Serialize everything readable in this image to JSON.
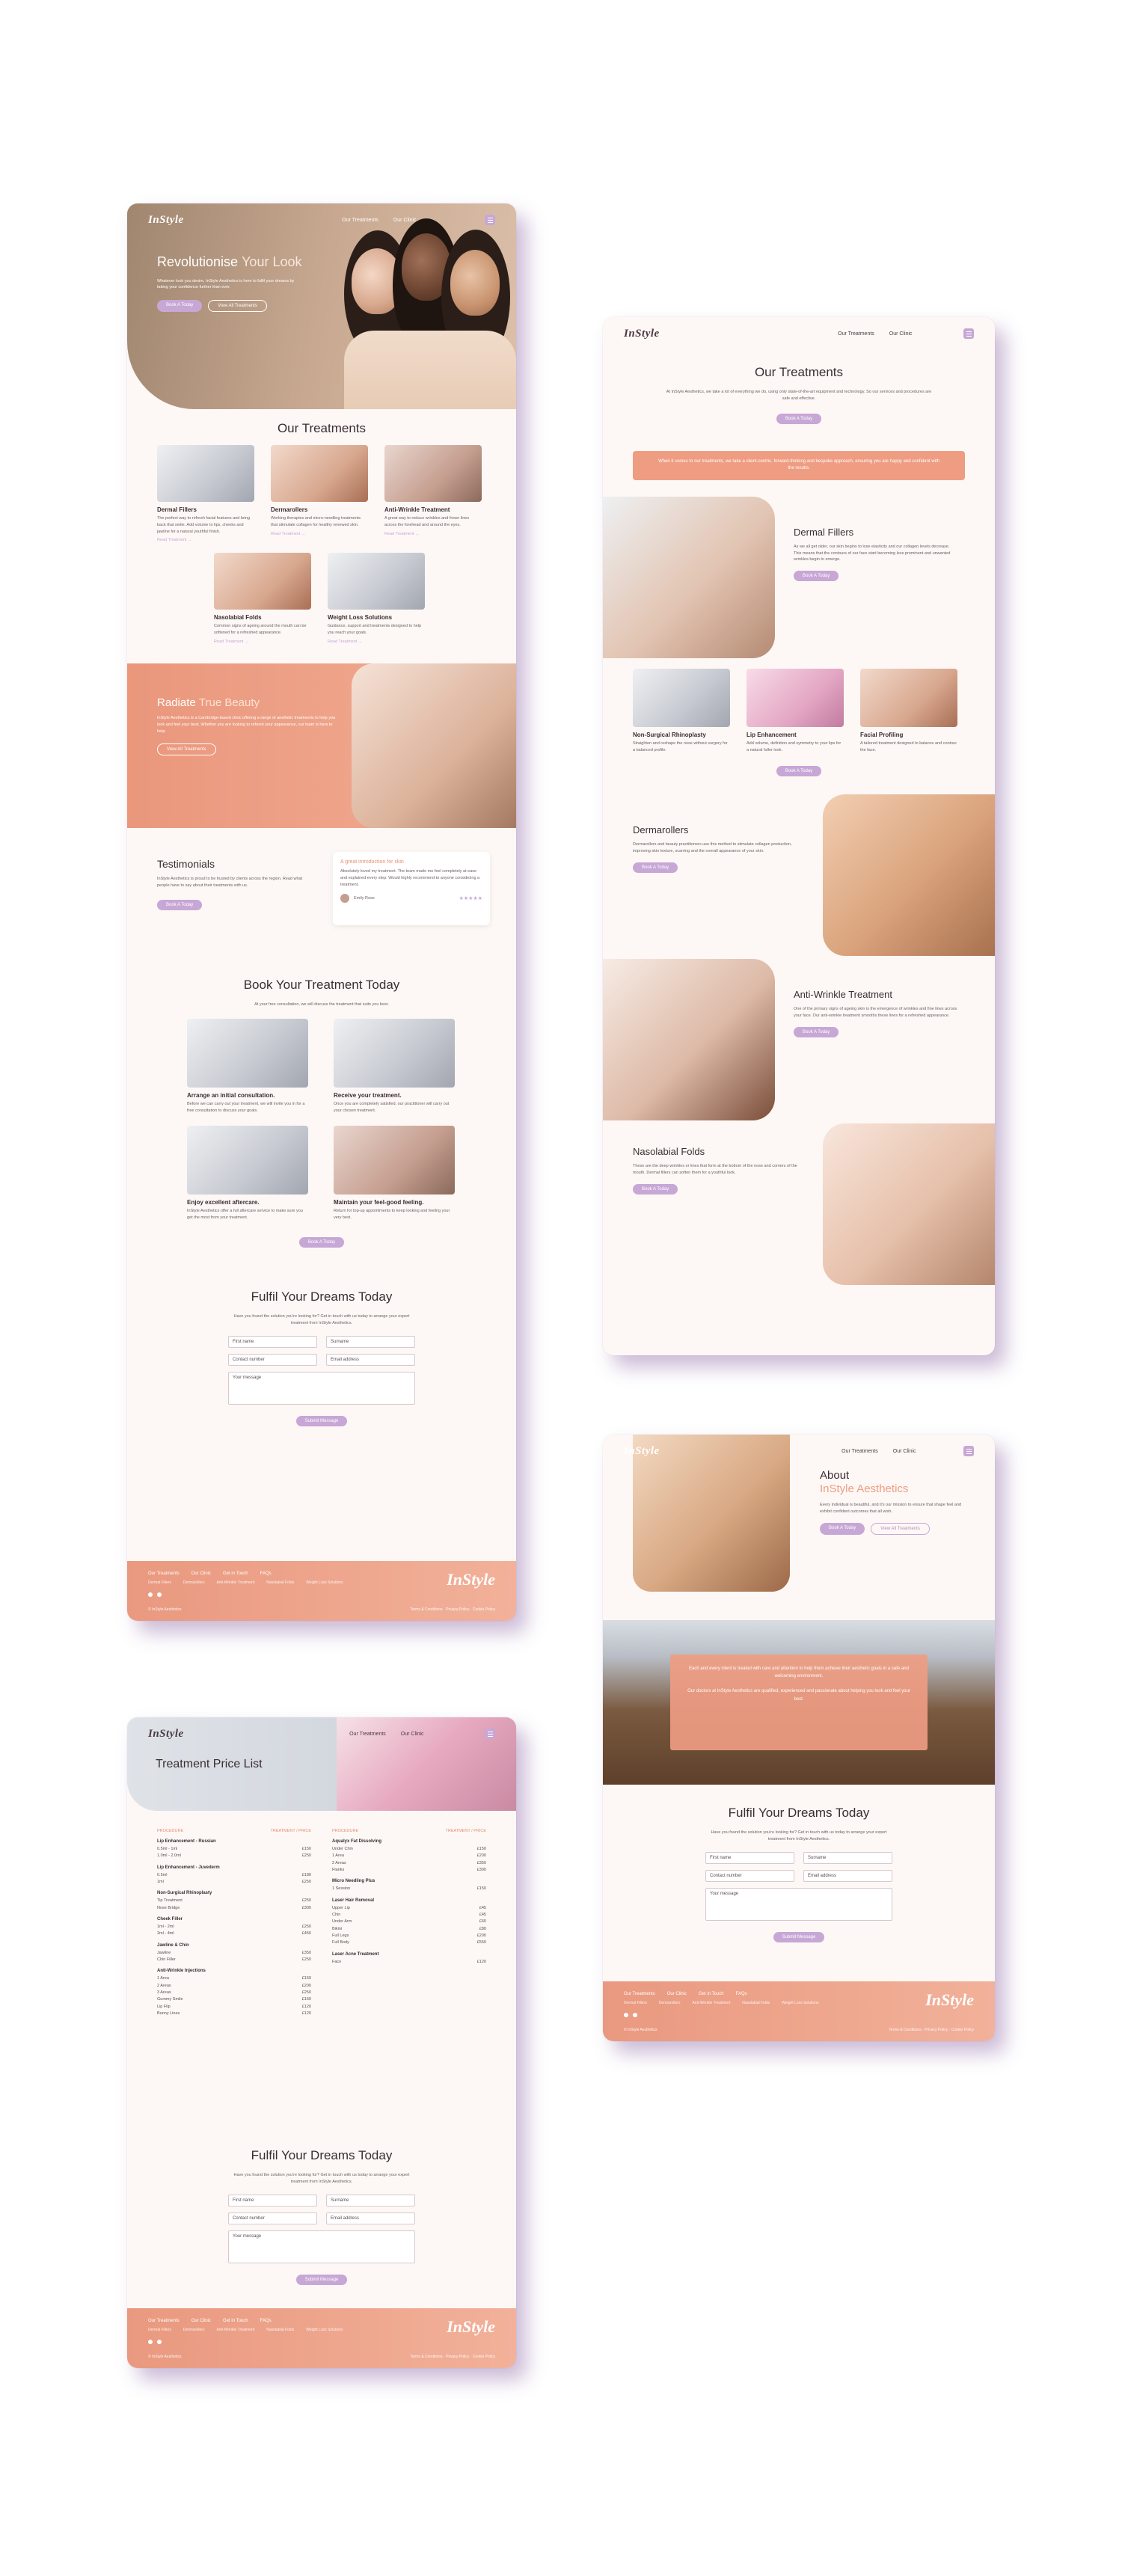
{
  "brand": {
    "logo": "InStyle",
    "accent": "#c7a7d6",
    "coral": "#ef9f85",
    "footer_logo": "InStyle"
  },
  "nav": {
    "treatments": "Our Treatments",
    "clinic": "Our Clinic"
  },
  "home": {
    "hero_title_a": "Revolutionise",
    "hero_title_b": "Your Look",
    "hero_text": "Whatever look you desire, InStyle Aesthetics is here to fulfil your dreams by taking your confidence further than ever.",
    "hero_btn1": "Book A Today",
    "hero_btn2": "View All Treatments",
    "treatments_title": "Our Treatments",
    "cards": [
      {
        "title": "Dermal Fillers",
        "text": "The perfect way to refresh facial features and bring back that smile. Add volume to lips, cheeks and jawline for a natural youthful finish.",
        "link": "Read Treatment →"
      },
      {
        "title": "Dermarollers",
        "text": "Working therapies and micro-needling treatments that stimulate collagen for healthy renewed skin.",
        "link": "Read Treatment →"
      },
      {
        "title": "Anti-Wrinkle Treatment",
        "text": "A great way to reduce wrinkles and frown lines across the forehead and around the eyes.",
        "link": "Read Treatment →"
      },
      {
        "title": "Nasolabial Folds",
        "text": "Common signs of ageing around the mouth can be softened for a refreshed appearance.",
        "link": "Read Treatment →"
      },
      {
        "title": "Weight Loss Solutions",
        "text": "Guidance, support and treatments designed to help you reach your goals.",
        "link": "Read Treatment →"
      }
    ],
    "radiate_a": "Radiate",
    "radiate_b": "True Beauty",
    "radiate_text": "InStyle Aesthetics is a Cambridge-based clinic offering a range of aesthetic treatments to help you look and feel your best. Whether you are looking to refresh your appearance, our team is here to help.",
    "radiate_btn": "View All Treatments",
    "testimonials_title": "Testimonials",
    "testimonials_text": "InStyle Aesthetics is proud to be trusted by clients across the region. Read what people have to say about their treatments with us.",
    "testimonials_btn": "Book A Today",
    "quote_title": "A great introduction for skin",
    "quote_text": "Absolutely loved my treatment. The team made me feel completely at ease and explained every step. Would highly recommend to anyone considering a treatment.",
    "quote_author": "Emily Rose",
    "book_title": "Book Your Treatment Today",
    "book_sub": "At your free consultation, we will discuss the treatment that suits you best.",
    "steps": [
      {
        "title": "Arrange an initial consultation.",
        "text": "Before we can carry out your treatment, we will invite you in for a free consultation to discuss your goals."
      },
      {
        "title": "Receive your treatment.",
        "text": "Once you are completely satisfied, our practitioner will carry out your chosen treatment."
      },
      {
        "title": "Enjoy excellent aftercare.",
        "text": "InStyle Aesthetics offer a full aftercare service to make sure you get the most from your treatment."
      },
      {
        "title": "Maintain your feel-good feeling.",
        "text": "Return for top-up appointments to keep looking and feeling your very best."
      }
    ],
    "book_btn": "Book A Today"
  },
  "contact": {
    "title": "Fulfil Your Dreams Today",
    "text": "Have you found the solution you're looking for? Get in touch with us today to arrange your expert treatment from InStyle Aesthetics.",
    "first": "First name",
    "surname": "Surname",
    "number": "Contact number",
    "email": "Email address",
    "message": "Your message",
    "submit": "Submit Message"
  },
  "footer": {
    "cols": [
      "Our Treatments",
      "Our Clinic",
      "Get in Touch",
      "FAQs"
    ],
    "sub": [
      "Dermal Fillers",
      "Dermarollers",
      "Anti-Wrinkle Treatment",
      "Nasolabial Folds",
      "Weight Loss Solutions"
    ],
    "copyright": "© InStyle Aesthetics",
    "legal": [
      "Terms & Conditions",
      "Privacy Policy",
      "Cookie Policy"
    ]
  },
  "treatments_page": {
    "title": "Our Treatments",
    "intro": "At InStyle Aesthetics, we take a lot of everything we do, using only state-of-the-art equipment and technology. So our services and procedures are safe and effective.",
    "btn": "Book A Today",
    "banner": "When it comes to our treatments, we take a client-centric, forward-thinking and bespoke approach, ensuring you are happy and confident with the results.",
    "dermal_title": "Dermal Fillers",
    "dermal_text": "As we all get older, our skin begins to lose elasticity and our collagen levels decrease. This means that the contours of our face start becoming less prominent and unwanted wrinkles begin to emerge.",
    "mini": [
      {
        "title": "Non-Surgical Rhinoplasty",
        "text": "Straighten and reshape the nose without surgery for a balanced profile."
      },
      {
        "title": "Lip Enhancement",
        "text": "Add volume, definition and symmetry to your lips for a natural fuller look."
      },
      {
        "title": "Facial Profiling",
        "text": "A tailored treatment designed to balance and contour the face."
      }
    ],
    "derma_title": "Dermarollers",
    "derma_text": "Dermarollers and beauty practitioners use this method to stimulate collagen production, improving skin texture, scarring and the overall appearance of your skin.",
    "anti_title": "Anti-Wrinkle Treatment",
    "anti_text": "One of the primary signs of ageing skin is the emergence of wrinkles and fine lines across your face. Our anti-wrinkle treatment smooths these lines for a refreshed appearance.",
    "naso_title": "Nasolabial Folds",
    "naso_text": "These are the deep wrinkles or lines that form at the bottom of the nose and corners of the mouth. Dermal fillers can soften them for a youthful look."
  },
  "about_page": {
    "title_a": "About",
    "title_b": "InStyle Aesthetics",
    "text": "Every individual is beautiful, and it's our mission to ensure that shape feel and exhibit confident outcomes that all wish.",
    "btn1": "Book A Today",
    "btn2": "View All Treatments",
    "panel_a": "Each and every client is treated with care and attention to help them achieve their aesthetic goals in a safe and welcoming environment.",
    "panel_b": "Our doctors at InStyle Aesthetics are qualified, experienced and passionate about helping you look and feel your best."
  },
  "price_page": {
    "title": "Treatment Price List",
    "col_head_a": "PROCEDURE",
    "col_head_b": "TREATMENT / PRICE",
    "left": [
      {
        "group": "Lip Enhancement - Russian",
        "items": [
          [
            "0.5ml - 1ml",
            "£150"
          ],
          [
            "1.0ml - 2.0ml",
            "£250"
          ]
        ]
      },
      {
        "group": "Lip Enhancement - Juvederm",
        "items": [
          [
            "0.5ml",
            "£180"
          ],
          [
            "1ml",
            "£250"
          ]
        ]
      },
      {
        "group": "Non-Surgical Rhinoplasty",
        "items": [
          [
            "Tip Treatment",
            "£250"
          ],
          [
            "Nose Bridge",
            "£300"
          ]
        ]
      },
      {
        "group": "Cheek Filler",
        "items": [
          [
            "1ml - 2ml",
            "£250"
          ],
          [
            "2ml - 4ml",
            "£450"
          ]
        ]
      },
      {
        "group": "Jawline & Chin",
        "items": [
          [
            "Jawline",
            "£350"
          ],
          [
            "Chin Filler",
            "£250"
          ]
        ]
      },
      {
        "group": "Anti-Wrinkle Injections",
        "items": [
          [
            "1 Area",
            "£150"
          ],
          [
            "2 Areas",
            "£200"
          ],
          [
            "3 Areas",
            "£250"
          ],
          [
            "Gummy Smile",
            "£150"
          ],
          [
            "Lip Flip",
            "£120"
          ],
          [
            "Bunny Lines",
            "£120"
          ]
        ]
      }
    ],
    "right": [
      {
        "group": "Aqualyx Fat Dissolving",
        "items": [
          [
            "Under Chin",
            "£150"
          ],
          [
            "1 Area",
            "£200"
          ],
          [
            "2 Areas",
            "£350"
          ],
          [
            "Flanks",
            "£300"
          ]
        ]
      },
      {
        "group": "Micro Needling Plus",
        "items": [
          [
            "1 Session",
            "£150"
          ]
        ]
      },
      {
        "group": "Laser Hair Removal",
        "items": [
          [
            "Upper Lip",
            "£45"
          ],
          [
            "Chin",
            "£45"
          ],
          [
            "Under Arm",
            "£60"
          ],
          [
            "Bikini",
            "£80"
          ],
          [
            "Full Legs",
            "£200"
          ],
          [
            "Full Body",
            "£550"
          ]
        ]
      },
      {
        "group": "Laser Acne Treatment",
        "items": [
          [
            "Face",
            "£120"
          ]
        ]
      }
    ]
  }
}
